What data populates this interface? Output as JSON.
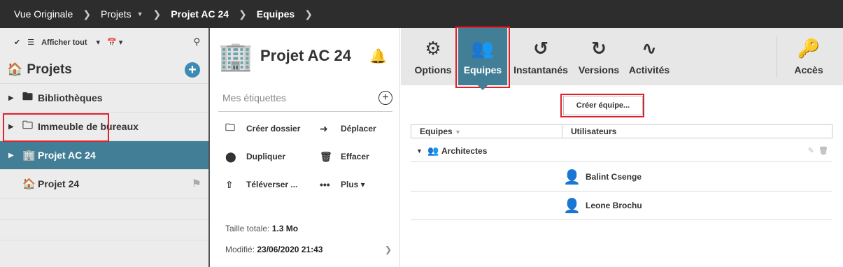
{
  "breadcrumb": {
    "items": [
      "Vue Originale",
      "Projets",
      "Projet AC 24",
      "Equipes"
    ]
  },
  "sidebar": {
    "toolbar": {
      "show_all": "Afficher tout"
    },
    "title": "Projets",
    "items": [
      {
        "label": "Bibliothèques"
      },
      {
        "label": "Immeuble de bureaux"
      },
      {
        "label": "Projet AC 24"
      },
      {
        "label": "Projet 24"
      }
    ]
  },
  "project": {
    "title": "Projet AC 24",
    "tags_placeholder": "Mes étiquettes",
    "actions": [
      "Créer dossier",
      "Déplacer",
      "Dupliquer",
      "Effacer",
      "Téléverser ...",
      "Plus"
    ],
    "size_label": "Taille totale:",
    "size_value": "1.3 Mo",
    "modified_label": "Modifié:",
    "modified_value": "23/06/2020 21:43"
  },
  "tabs": [
    "Options",
    "Equipes",
    "Instantanés",
    "Versions",
    "Activités",
    "Accès"
  ],
  "teams": {
    "create_button": "Créer équipe...",
    "col_teams": "Equipes",
    "col_users": "Utilisateurs",
    "team_name": "Architectes",
    "users": [
      "Balint Csenge",
      "Leone Brochu"
    ]
  },
  "colors": {
    "accent": "#437e97",
    "highlight": "#e2212b",
    "add": "#3d8bb5"
  }
}
